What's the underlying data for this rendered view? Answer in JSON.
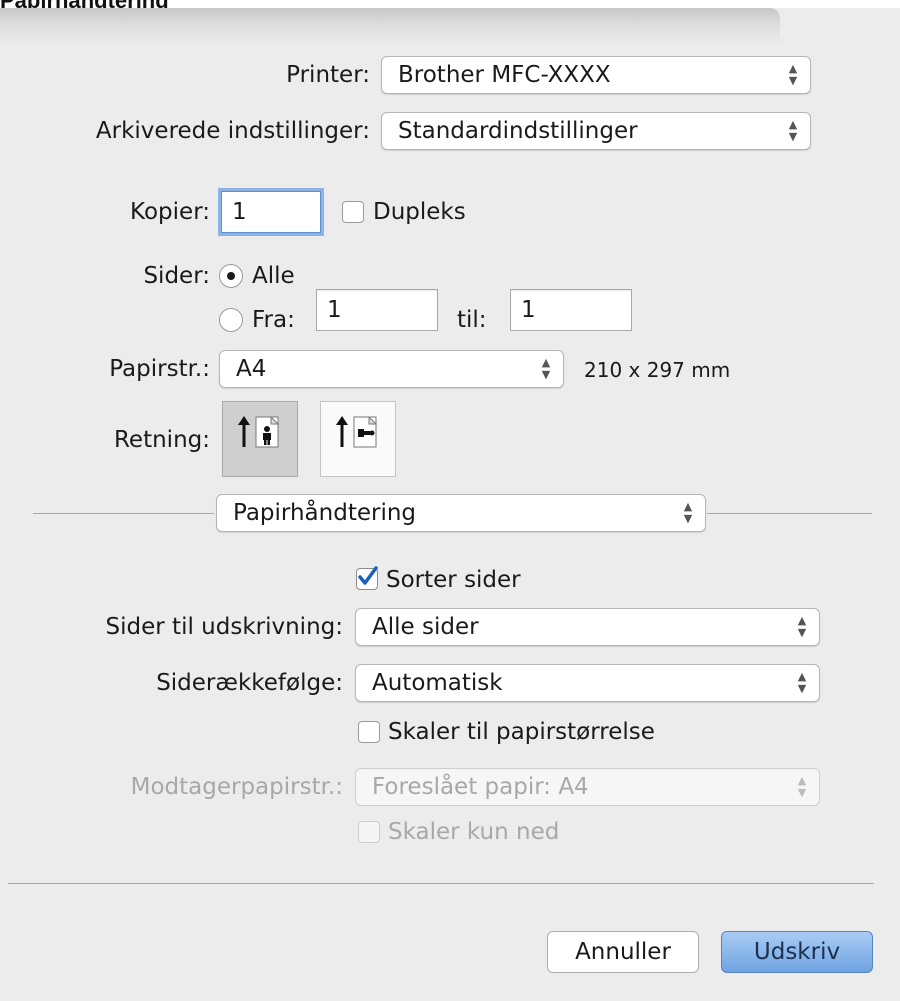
{
  "caption": "Papirhåndtering",
  "printer": {
    "label": "Printer:",
    "value": "Brother MFC-XXXX"
  },
  "presets": {
    "label": "Arkiverede indstillinger:",
    "value": "Standardindstillinger"
  },
  "copies": {
    "label": "Kopier:",
    "value": "1",
    "duplex_label": "Dupleks",
    "duplex_checked": false
  },
  "pages": {
    "label": "Sider:",
    "all_label": "Alle",
    "from_label": "Fra:",
    "from_value": "1",
    "to_label": "til:",
    "to_value": "1",
    "selected": "all"
  },
  "paper_size": {
    "label": "Papirstr.:",
    "value": "A4",
    "dimensions": "210 x 297 mm"
  },
  "orientation": {
    "label": "Retning:",
    "selected": "portrait"
  },
  "section": {
    "value": "Papirhåndtering"
  },
  "collate": {
    "label": "Sorter sider",
    "checked": true
  },
  "pages_to_print": {
    "label": "Sider til udskrivning:",
    "value": "Alle sider"
  },
  "page_order": {
    "label": "Siderækkefølge:",
    "value": "Automatisk"
  },
  "scale_to_fit": {
    "label": "Skaler til papirstørrelse",
    "checked": false
  },
  "dest_paper": {
    "label": "Modtagerpapirstr.:",
    "value": "Foreslået papir: A4",
    "enabled": false
  },
  "scale_down": {
    "label": "Skaler kun ned",
    "enabled": false
  },
  "buttons": {
    "cancel": "Annuller",
    "print": "Udskriv"
  },
  "colors": {
    "accent": "#8cb2e6",
    "default_button": "#6fa3e1",
    "check": "#1a5fbf"
  }
}
